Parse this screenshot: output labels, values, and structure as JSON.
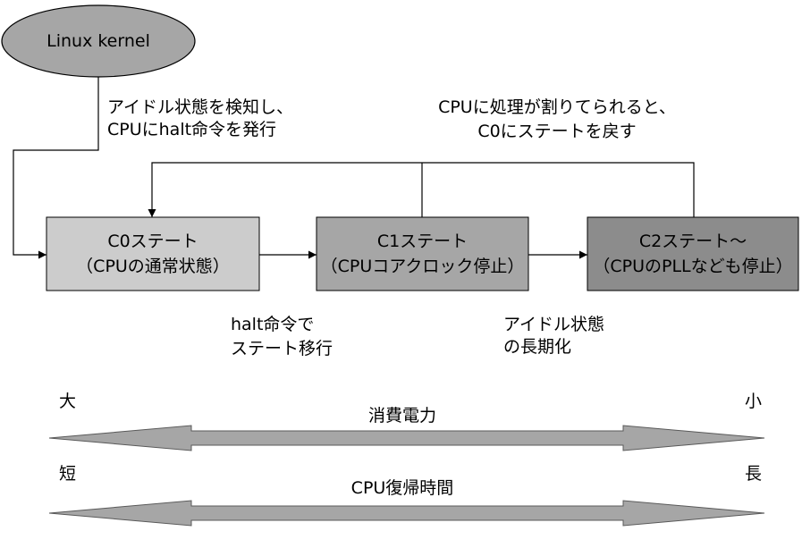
{
  "kernel": {
    "label": "Linux kernel"
  },
  "annotations": {
    "halt_issue": [
      "アイドル状態を検知し、",
      "CPUにhalt命令を発行"
    ],
    "return_c0": [
      "CPUに処理が割りてられると、",
      "C0にステートを戻す"
    ],
    "halt_transition": [
      "halt命令で",
      "ステート移行"
    ],
    "idle_longer": [
      "アイドル状態",
      "の長期化"
    ]
  },
  "states": [
    {
      "name": "C0ステート",
      "desc": "（CPUの通常状態）",
      "fill": "#cccccc"
    },
    {
      "name": "C1ステート",
      "desc": "（CPUコアクロック停止）",
      "fill": "#a6a6a6"
    },
    {
      "name": "C2ステート〜",
      "desc": "（CPUのPLLなども停止）",
      "fill": "#8c8c8c"
    }
  ],
  "scales": [
    {
      "label": "消費電力",
      "left": "大",
      "right": "小"
    },
    {
      "label": "CPU復帰時間",
      "left": "短",
      "right": "長"
    }
  ],
  "colors": {
    "kernel_fill": "#a6a6a6",
    "arrow_fill": "#a6a6a6",
    "line": "#000000"
  }
}
